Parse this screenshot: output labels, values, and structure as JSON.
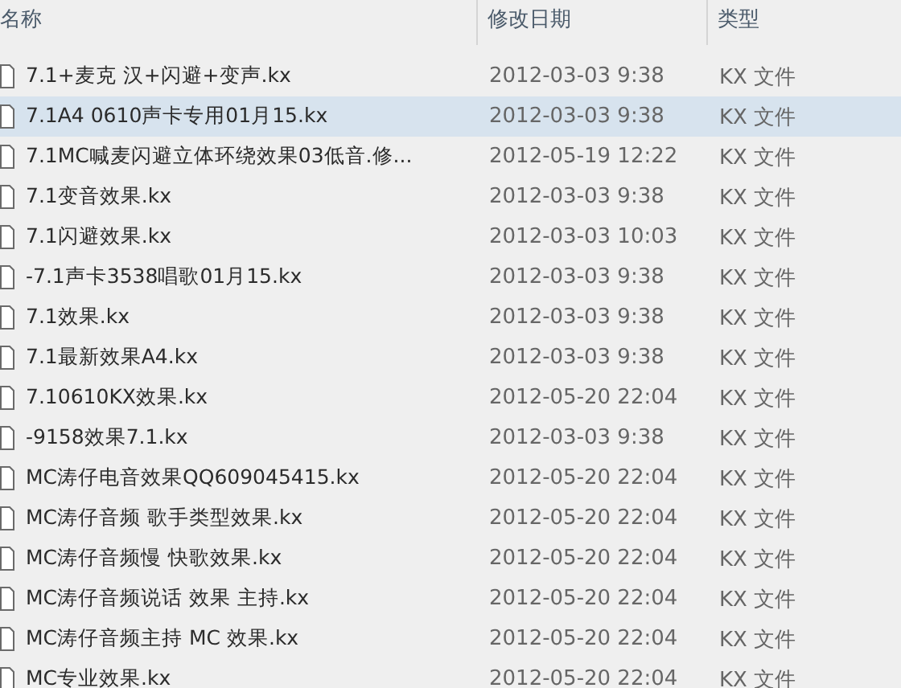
{
  "columns": [
    {
      "label": "名称"
    },
    {
      "label": "修改日期"
    },
    {
      "label": "类型"
    }
  ],
  "files": [
    {
      "name": "7.1+麦克 汉+闪避+变声.kx",
      "date": "2012-03-03 9:38",
      "type": "KX 文件",
      "selected": false
    },
    {
      "name": "7.1A4 0610声卡专用01月15.kx",
      "date": "2012-03-03 9:38",
      "type": "KX 文件",
      "selected": true
    },
    {
      "name": "7.1MC喊麦闪避立体环绕效果03低音.修...",
      "date": "2012-05-19 12:22",
      "type": "KX 文件",
      "selected": false
    },
    {
      "name": "7.1变音效果.kx",
      "date": "2012-03-03 9:38",
      "type": "KX 文件",
      "selected": false
    },
    {
      "name": "7.1闪避效果.kx",
      "date": "2012-03-03 10:03",
      "type": "KX 文件",
      "selected": false
    },
    {
      "name": "-7.1声卡3538唱歌01月15.kx",
      "date": "2012-03-03 9:38",
      "type": "KX 文件",
      "selected": false
    },
    {
      "name": "7.1效果.kx",
      "date": "2012-03-03 9:38",
      "type": "KX 文件",
      "selected": false
    },
    {
      "name": "7.1最新效果A4.kx",
      "date": "2012-03-03 9:38",
      "type": "KX 文件",
      "selected": false
    },
    {
      "name": "7.10610KX效果.kx",
      "date": "2012-05-20 22:04",
      "type": "KX 文件",
      "selected": false
    },
    {
      "name": "-9158效果7.1.kx",
      "date": "2012-03-03 9:38",
      "type": "KX 文件",
      "selected": false
    },
    {
      "name": "MC涛仔电音效果QQ609045415.kx",
      "date": "2012-05-20 22:04",
      "type": "KX 文件",
      "selected": false
    },
    {
      "name": "MC涛仔音频 歌手类型效果.kx",
      "date": "2012-05-20 22:04",
      "type": "KX 文件",
      "selected": false
    },
    {
      "name": "MC涛仔音频慢 快歌效果.kx",
      "date": "2012-05-20 22:04",
      "type": "KX 文件",
      "selected": false
    },
    {
      "name": "MC涛仔音频说话 效果 主持.kx",
      "date": "2012-05-20 22:04",
      "type": "KX 文件",
      "selected": false
    },
    {
      "name": "MC涛仔音频主持 MC 效果.kx",
      "date": "2012-05-20 22:04",
      "type": "KX 文件",
      "selected": false
    },
    {
      "name": "MC专业效果.kx",
      "date": "2012-05-20 22:04",
      "type": "KX 文件",
      "selected": false
    }
  ]
}
